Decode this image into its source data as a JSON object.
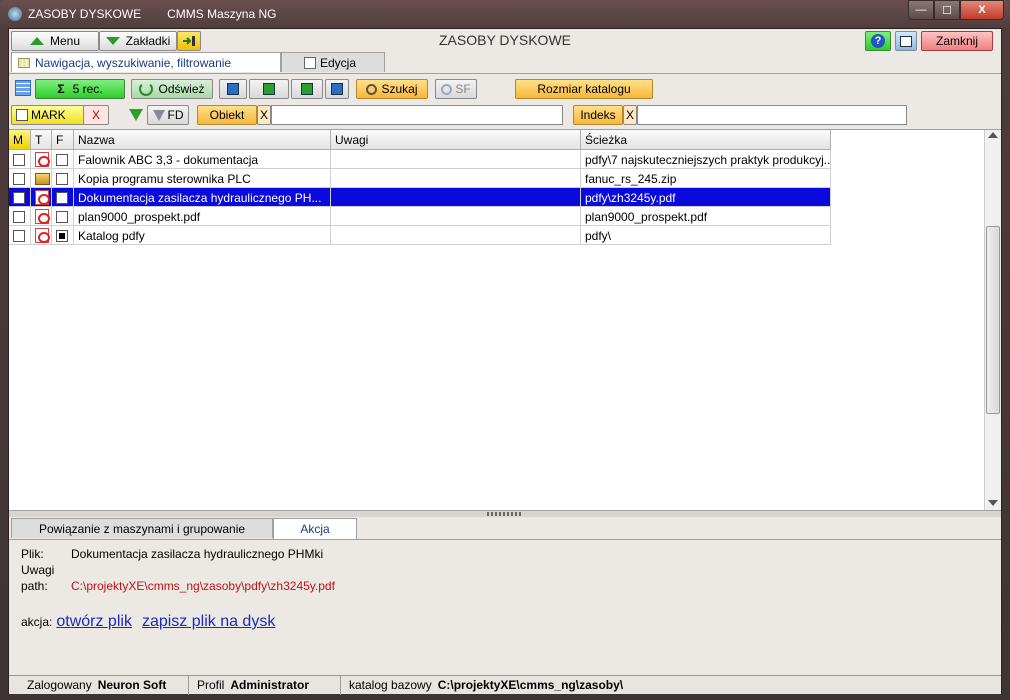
{
  "window": {
    "title": "ZASOBY DYSKOWE",
    "subtitle": "CMMS Maszyna NG",
    "min": "—",
    "max": "☐",
    "close": "X"
  },
  "header": {
    "menu_label": "Menu",
    "bookmarks_label": "Zakładki",
    "page_title": "ZASOBY DYSKOWE",
    "help": "?",
    "close_label": "Zamknij"
  },
  "tabs": [
    {
      "label": "Nawigacja, wyszukiwanie, filtrowanie",
      "active": true
    },
    {
      "label": "Edycja",
      "active": false
    }
  ],
  "toolbar": {
    "records": "5 rec.",
    "refresh": "Odśwież",
    "search": "Szukaj",
    "sf": "SF",
    "catalog_size": "Rozmiar katalogu"
  },
  "filters": {
    "mark": "MARK",
    "clear": "X",
    "fd": "FD",
    "object_label": "Obiekt",
    "object_value": "",
    "index_label": "Indeks",
    "index_value": ""
  },
  "grid": {
    "columns": [
      "M",
      "T",
      "F",
      "Nazwa",
      "Uwagi",
      "Ścieżka"
    ],
    "rows": [
      {
        "type": "pdf",
        "f_checked": false,
        "name": "Falownik ABC 3,3 - dokumentacja",
        "notes": "",
        "path": "pdfy\\7 najskuteczniejszych praktyk produkcyj...",
        "selected": false
      },
      {
        "type": "box",
        "f_checked": false,
        "name": "Kopia programu sterownika PLC",
        "notes": "",
        "path": "fanuc_rs_245.zip",
        "selected": false
      },
      {
        "type": "pdf",
        "f_checked": false,
        "name": "Dokumentacja zasilacza hydraulicznego PH...",
        "notes": "",
        "path": "pdfy\\zh3245y.pdf",
        "selected": true
      },
      {
        "type": "pdf",
        "f_checked": false,
        "name": "plan9000_prospekt.pdf",
        "notes": "",
        "path": "plan9000_prospekt.pdf",
        "selected": false
      },
      {
        "type": "pdf",
        "f_checked": true,
        "name": "Katalog pdfy",
        "notes": "",
        "path": "pdfy\\",
        "selected": false
      }
    ]
  },
  "bottom_tabs": [
    {
      "label": "Powiązanie z maszynami i grupowanie",
      "active": false
    },
    {
      "label": "Akcja",
      "active": true
    }
  ],
  "detail": {
    "file_label": "Plik:",
    "file_value": "Dokumentacja zasilacza hydraulicznego PHMki",
    "notes_label": "Uwagi",
    "path_label": "path:",
    "path_prefix": "C:\\projektyXE\\cmms_ng\\zasoby\\",
    "path_suffix": "pdfy\\zh3245y.pdf",
    "action_label": "akcja:",
    "open_link": "otwórz plik",
    "save_link": "zapisz plik na dysk"
  },
  "status": {
    "logged_label": "Zalogowany",
    "logged_value": "Neuron Soft",
    "profile_label": "Profil",
    "profile_value": "Administrator",
    "catalog_label": "katalog bazowy",
    "catalog_value": "C:\\projektyXE\\cmms_ng\\zasoby\\"
  }
}
